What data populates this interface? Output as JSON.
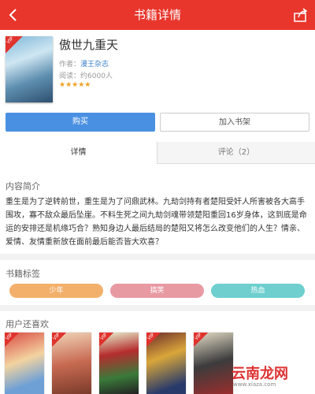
{
  "header": {
    "title": "书籍详情"
  },
  "book": {
    "title": "傲世九重天",
    "author_label": "作者：",
    "author": "漫王杂志",
    "reads_label": "阅读：",
    "reads": "约6000人",
    "rating": "★★★★★",
    "vip_badge": "VIP"
  },
  "actions": {
    "buy": "购买",
    "add_shelf": "加入书架"
  },
  "tabs": {
    "detail": "详情",
    "comments": "评论（2）"
  },
  "intro": {
    "title": "内容简介",
    "text": "重生是为了逆转前世，重生是为了问鼎武林。九劫剑持有者楚阳受奸人所害被各大高手围攻，寡不敌众最后坠崖。不料生死之间九劫剑魂带领楚阳重回16岁身体，这到底是命运的安排还是机缘巧合？熟知身边人最后结局的楚阳又将怎么改变他们的人生？情亲、爱情、友情重新放在面前最后能否皆大欢喜？"
  },
  "tags": {
    "title": "书籍标签",
    "items": [
      "少年",
      "搞笑",
      "热血"
    ]
  },
  "recommend": {
    "title": "用户还喜欢"
  },
  "watermark": {
    "text": "云南龙网",
    "sub": "www.xiaza.com"
  },
  "colors": {
    "accent": "#e8362c",
    "button_blue": "#4a90e2"
  }
}
